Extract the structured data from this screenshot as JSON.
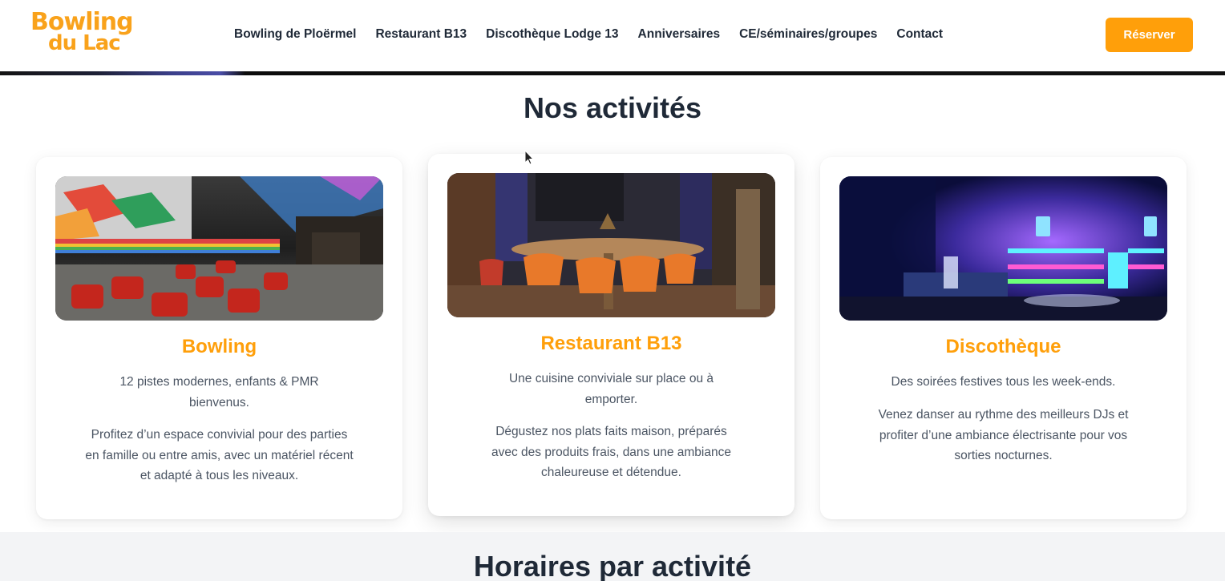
{
  "header": {
    "logo_line1": "Bowling",
    "logo_line2": "du Lac",
    "nav": [
      "Bowling de Ploërmel",
      "Restaurant B13",
      "Discothèque Lodge 13",
      "Anniversaires",
      "CE/séminaires/groupes",
      "Contact"
    ],
    "reserve_label": "Réserver"
  },
  "activities": {
    "title": "Nos activités",
    "cards": [
      {
        "title": "Bowling",
        "text1": "12 pistes modernes, enfants & PMR bienvenus.",
        "text2": "Profitez d’un espace convivial pour des parties en famille ou entre amis, avec un matériel récent et adapté à tous les niveaux."
      },
      {
        "title": "Restaurant B13",
        "text1": "Une cuisine conviviale sur place ou à emporter.",
        "text2": "Dégustez nos plats faits maison, préparés avec des produits frais, dans une ambiance chaleureuse et détendue."
      },
      {
        "title": "Discothèque",
        "text1": "Des soirées festives tous les week-ends.",
        "text2": "Venez danser au rythme des meilleurs DJs et profiter d’une ambiance électrisante pour vos sorties nocturnes."
      }
    ]
  },
  "horaires": {
    "title": "Horaires par activité"
  },
  "colors": {
    "accent": "#ff9f0a",
    "logo": "#f9a21b",
    "text": "#1f2937",
    "muted": "#4b5563"
  }
}
